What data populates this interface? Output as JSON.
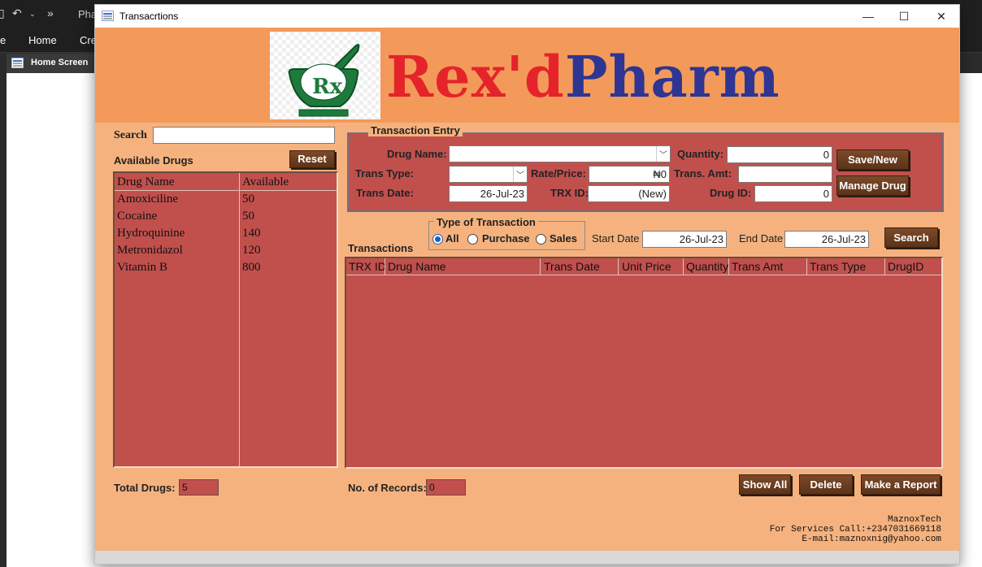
{
  "background_app": {
    "qat_file_name": "Pha",
    "ribbon_tabs": [
      "Home",
      "Cre"
    ],
    "ribbon_left_fragment": "e",
    "doc_tab": "Home Screen"
  },
  "window": {
    "title": "Transacrtions",
    "controls": {
      "minimize": "—",
      "maximize": "☐",
      "close": "✕"
    }
  },
  "banner": {
    "brand_red": "Rex'd",
    "brand_blue": "Pharm",
    "logo_text": "Rx"
  },
  "left": {
    "search_label": "Search",
    "search_value": "",
    "available_label": "Available Drugs",
    "reset_label": "Reset",
    "list_headers": [
      "Drug Name",
      "Available"
    ],
    "drugs": [
      {
        "name": "Amoxiciline",
        "available": "50"
      },
      {
        "name": "Cocaine",
        "available": "50"
      },
      {
        "name": "Hydroquinine",
        "available": "140"
      },
      {
        "name": "Metronidazol",
        "available": "120"
      },
      {
        "name": "Vitamin B",
        "available": "800"
      }
    ],
    "total_label": "Total Drugs:",
    "total_value": "5"
  },
  "entry": {
    "legend": "Transaction Entry",
    "drug_name_label": "Drug Name:",
    "drug_name_value": "",
    "trans_type_label": "Trans Type:",
    "trans_type_value": "",
    "trans_date_label": "Trans Date:",
    "trans_date_value": "26-Jul-23",
    "rate_label": "Rate/Price:",
    "rate_value": "₦0",
    "trx_label": "TRX ID:",
    "trx_value": "(New)",
    "quantity_label": "Quantity:",
    "quantity_value": "0",
    "trans_amt_label": "Trans. Amt:",
    "trans_amt_value": "",
    "drug_id_label": "Drug ID:",
    "drug_id_value": "0",
    "save_label": "Save/New",
    "manage_label": "Manage Drug"
  },
  "filter": {
    "transactions_label": "Transactions",
    "type_legend": "Type of Transaction",
    "options": [
      "All",
      "Purchase",
      "Sales"
    ],
    "selected": "All",
    "start_label": "Start Date",
    "start_value": "26-Jul-23",
    "end_label": "End Date",
    "end_value": "26-Jul-23",
    "search_label": "Search"
  },
  "grid": {
    "columns": [
      "TRX ID",
      "Drug Name",
      "Trans Date",
      "Unit Price",
      "Quantity",
      "Trans Amt",
      "Trans Type",
      "DrugID"
    ]
  },
  "bottom": {
    "records_label": "No. of Records:",
    "records_value": "0",
    "show_all_label": "Show All",
    "delete_label": "Delete",
    "report_label": "Make a Report"
  },
  "footer": {
    "line1": "MaznoxTech",
    "line2": "For  Services Call:+2347031669118",
    "line3": "E-mail:maznoxnig@yahoo.com"
  },
  "colors": {
    "form_bg": "#f6b27e",
    "banner_bg": "#f39a5a",
    "panel_red": "#c1504d",
    "button_brown": "#6b3d20"
  }
}
